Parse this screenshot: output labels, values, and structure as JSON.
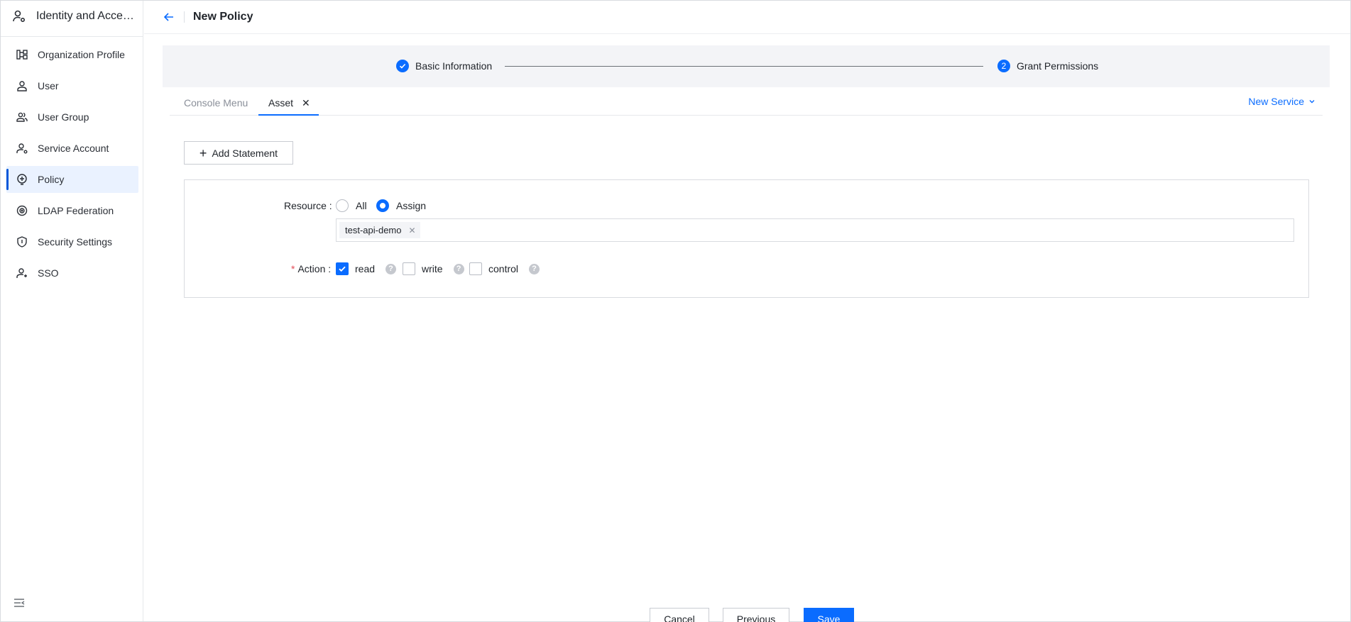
{
  "sidebar": {
    "title": "Identity and Access Management",
    "items": [
      {
        "label": "Organization Profile",
        "icon": "org-tree-icon"
      },
      {
        "label": "User",
        "icon": "user-icon"
      },
      {
        "label": "User Group",
        "icon": "user-group-icon"
      },
      {
        "label": "Service Account",
        "icon": "service-account-icon"
      },
      {
        "label": "Policy",
        "icon": "policy-icon",
        "active": true
      },
      {
        "label": "LDAP Federation",
        "icon": "ldap-icon"
      },
      {
        "label": "Security Settings",
        "icon": "shield-icon"
      },
      {
        "label": "SSO",
        "icon": "sso-icon"
      }
    ]
  },
  "header": {
    "title": "New Policy"
  },
  "steps": [
    {
      "label": "Basic Information",
      "status": "done"
    },
    {
      "label": "Grant Permissions",
      "number": "2",
      "status": "current"
    }
  ],
  "tabs": {
    "items": [
      "Console Menu",
      "Asset"
    ],
    "active": "Asset",
    "new_service": "New Service"
  },
  "statement": {
    "add_label": "Add Statement",
    "resource_label": "Resource",
    "resource_options": [
      "All",
      "Assign"
    ],
    "resource_selected": "Assign",
    "resource_tags": [
      "test-api-demo"
    ],
    "action_label": "Action",
    "actions": [
      {
        "label": "read",
        "checked": true
      },
      {
        "label": "write",
        "checked": false
      },
      {
        "label": "control",
        "checked": false
      }
    ]
  },
  "footer": {
    "cancel": "Cancel",
    "previous": "Previous",
    "save": "Save"
  },
  "colors": {
    "primary": "#0a6cff",
    "active_bg": "#eaf2ff",
    "required": "#e34d59"
  }
}
